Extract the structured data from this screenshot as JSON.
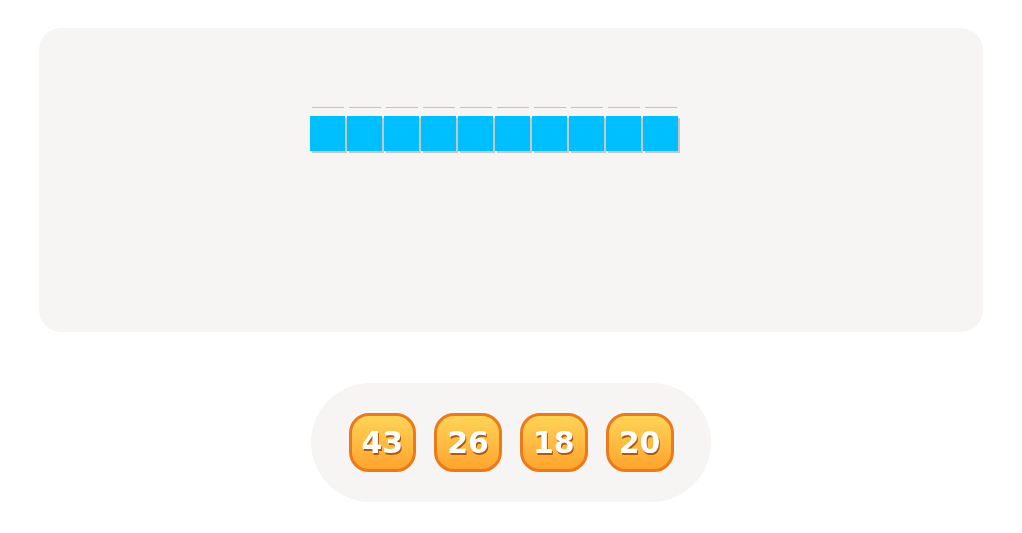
{
  "blocks": [
    {
      "kind": "filled"
    },
    {
      "kind": "filled"
    },
    {
      "kind": "filled"
    },
    {
      "kind": "filled"
    },
    {
      "kind": "filled"
    },
    {
      "kind": "filled"
    },
    {
      "kind": "filled"
    },
    {
      "kind": "filled"
    },
    {
      "kind": "filled"
    },
    {
      "kind": "filled"
    }
  ],
  "answers": [
    "43",
    "26",
    "18",
    "20"
  ]
}
